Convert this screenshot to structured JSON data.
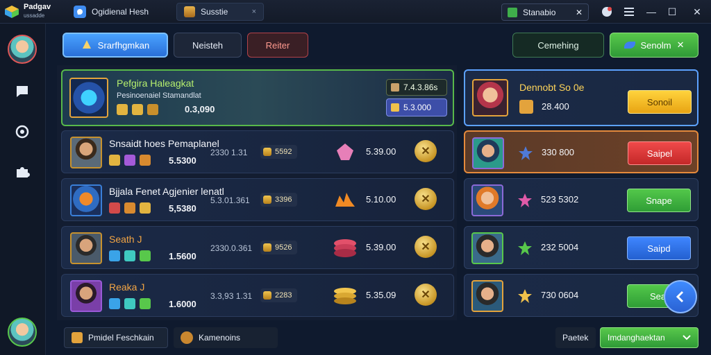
{
  "app": {
    "name": "Padgav",
    "subtitle": "ussadde"
  },
  "tabs": [
    {
      "label": "Ogidienal Hesh"
    },
    {
      "label": "Susstie",
      "close": "×"
    }
  ],
  "window_tab": {
    "label": "Stanabio",
    "close": "✕"
  },
  "window_controls": {
    "min": "—",
    "max": "☐",
    "close": "✕"
  },
  "toolbar": {
    "search_label": "Srarfhgmkan",
    "neutral_label": "Neisteh",
    "red_label": "Reiter",
    "outline_label": "Cemehing",
    "green_label": "Senolm",
    "green_close": "✕"
  },
  "featured": {
    "title": "Pefgira Haleagkat",
    "subtitle": "Pesinoenaiel Stamandlat",
    "value": "0.3,090",
    "badge_a": "7.4.3.86s",
    "badge_b": "5.3.000"
  },
  "rows": [
    {
      "title": "Snsaidt hoes Pemaplanel",
      "value": "5.5300",
      "time": "2330 1.31",
      "pill": "5592",
      "price": "5.39.00",
      "gem": "pink"
    },
    {
      "title": "Bjjala Fenet Agjenier lenatl",
      "value": "5,5380",
      "time": "5.3.01.361",
      "pill": "3396",
      "price": "5.10.00",
      "gem": "fire"
    },
    {
      "title": "Seath J",
      "value": "1.5600",
      "time": "2330.0.361",
      "pill": "9526",
      "price": "5.39.00",
      "gem": "stack"
    },
    {
      "title": "Reaka J",
      "value": "1.6000",
      "time": "3.3,93 1.31",
      "pill": "2283",
      "price": "5.35.09",
      "gem": "coins"
    }
  ],
  "right": {
    "first": {
      "title": "Dennobt So 0e",
      "value": "28.400",
      "button": "Sonoil"
    },
    "cards": [
      {
        "value": "330 800",
        "button": "Saipel",
        "style": "red"
      },
      {
        "value": "523 5302",
        "button": "Snape",
        "style": "green"
      },
      {
        "value": "232 5004",
        "button": "Saipd",
        "style": "blue"
      },
      {
        "value": "730 0604",
        "button": "Seaj",
        "style": "green"
      }
    ]
  },
  "bottom": {
    "btn1": "Pmidel Feschkain",
    "btn2": "Kamenoins",
    "btn3": "Paetek",
    "btn4": "Imdanghaektan"
  },
  "colors": {
    "accent_blue": "#3f86ff",
    "accent_green": "#4fbf45",
    "accent_gold": "#e8a413"
  }
}
